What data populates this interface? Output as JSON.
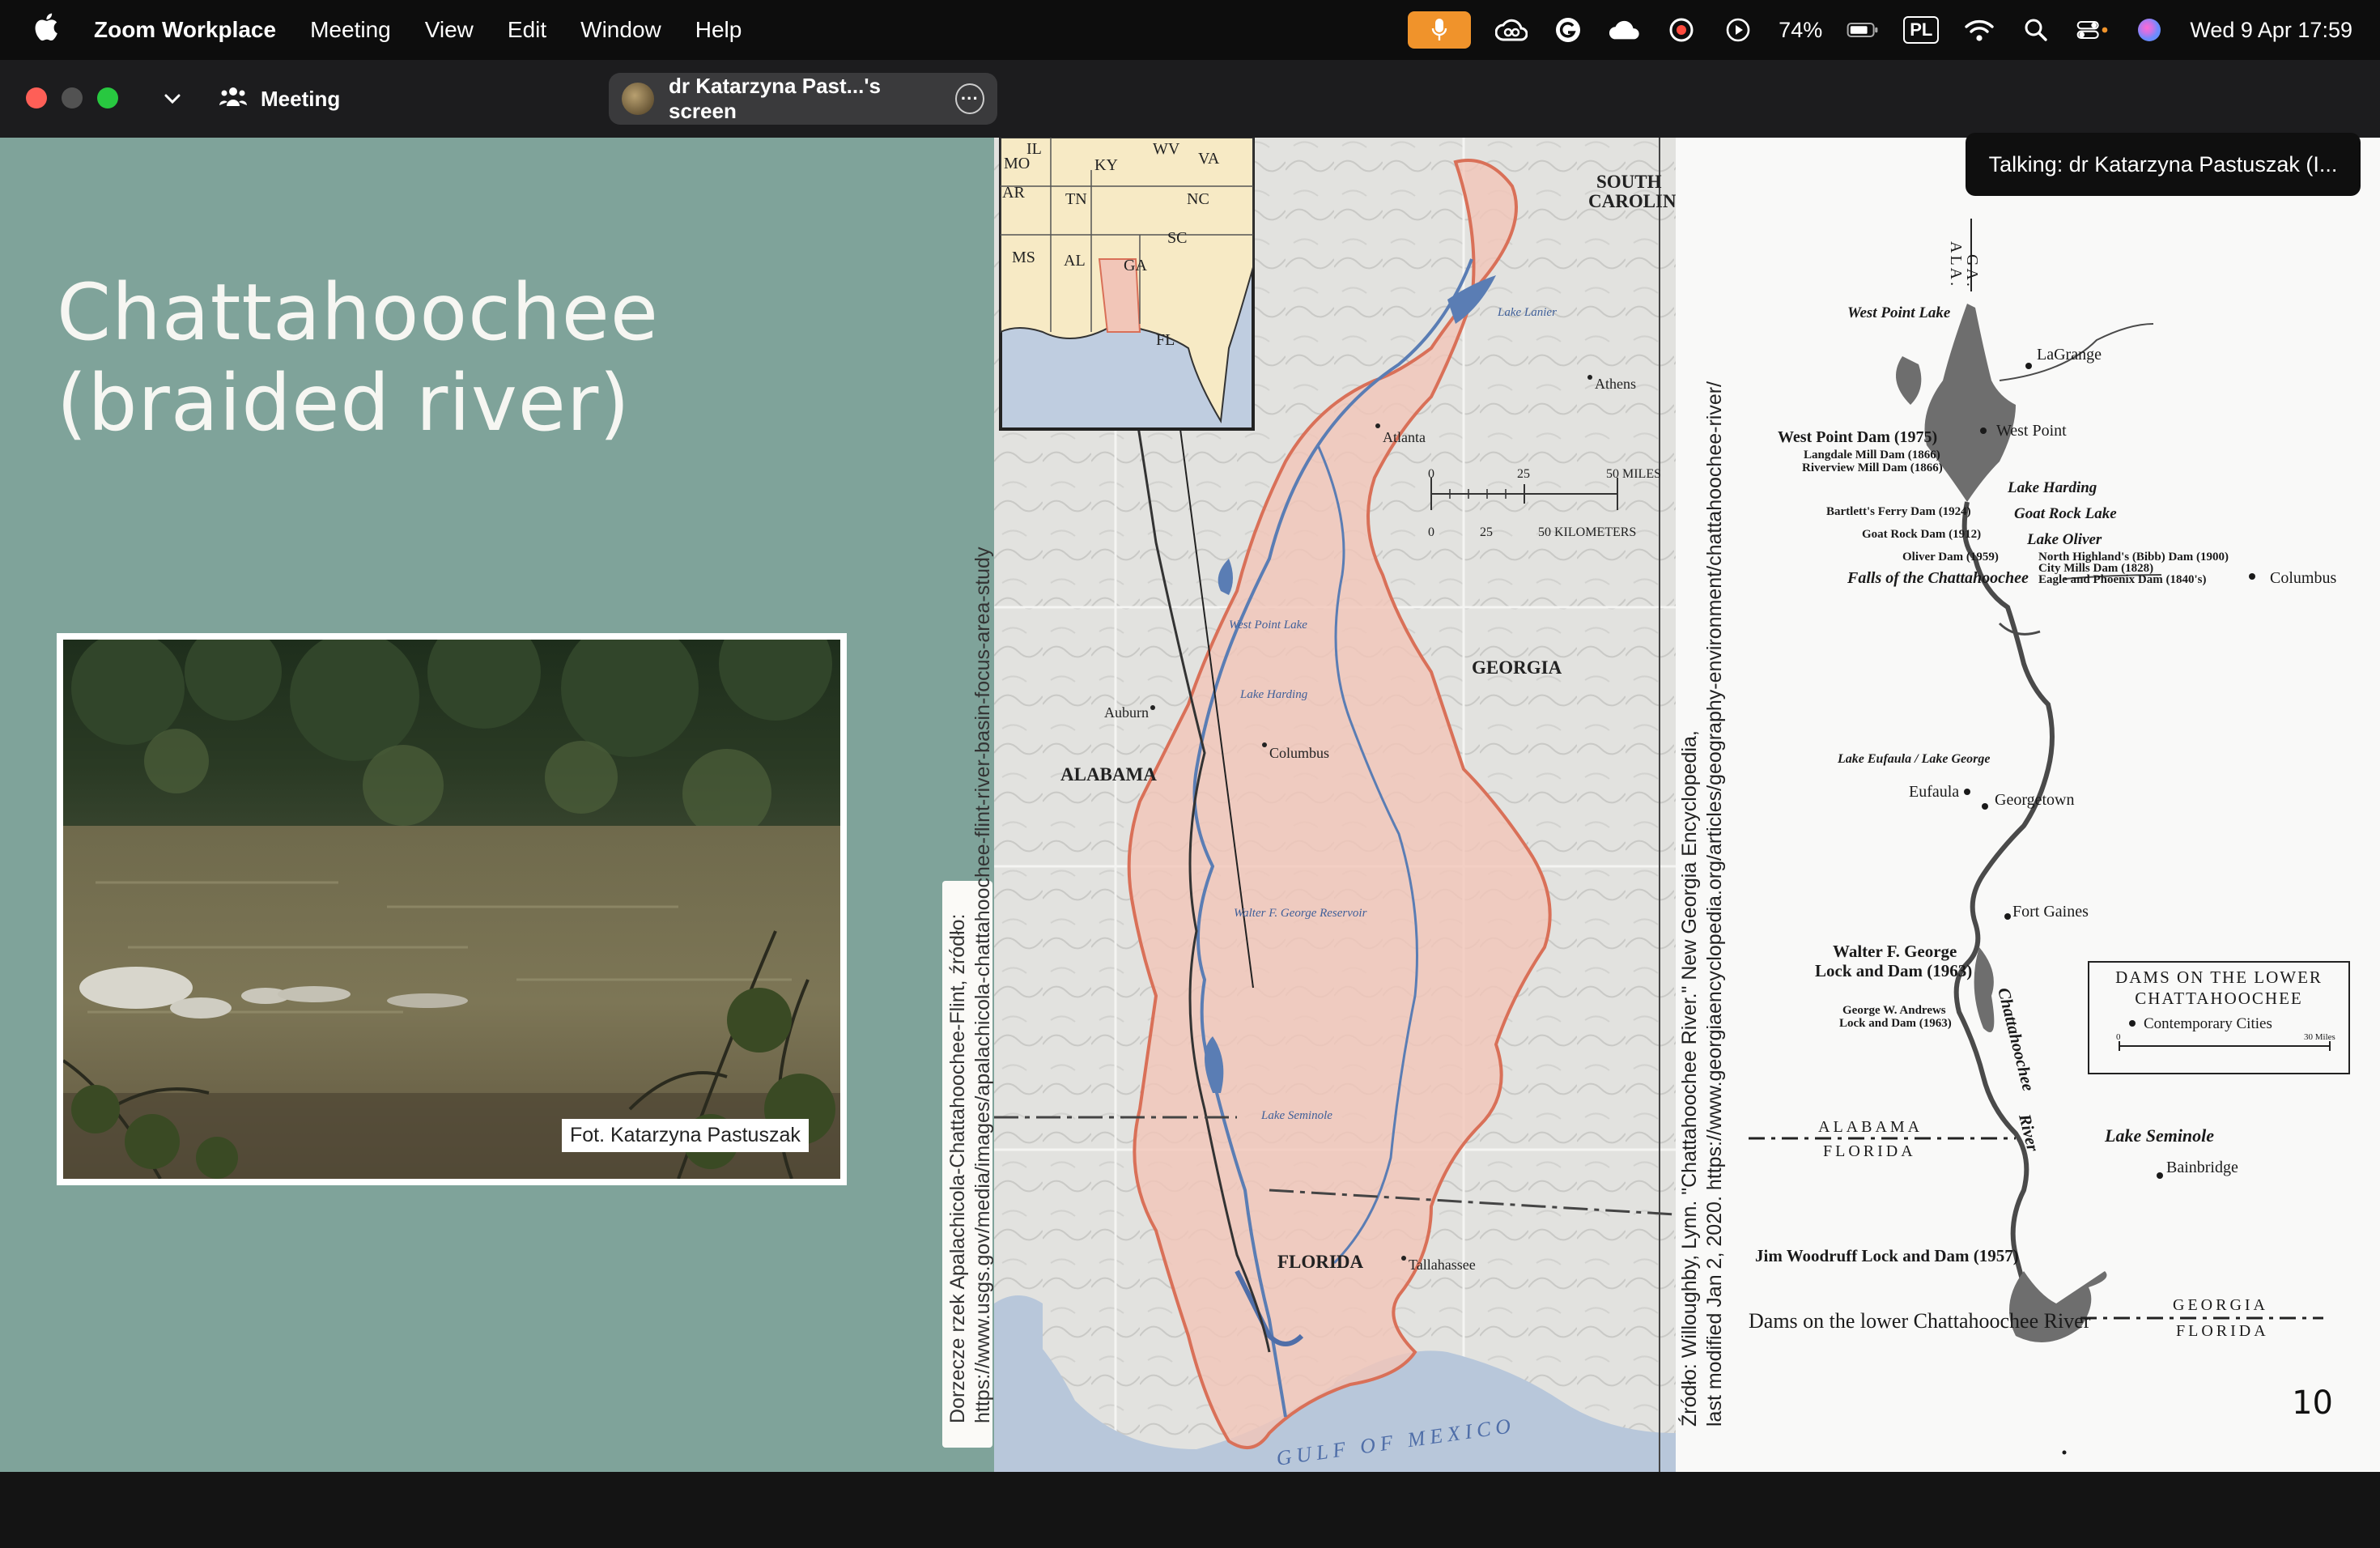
{
  "menubar": {
    "app_name": "Zoom Workplace",
    "menus": [
      "Meeting",
      "View",
      "Edit",
      "Window",
      "Help"
    ],
    "battery_percent": "74%",
    "input_source": "PL",
    "clock": "Wed 9 Apr  17:59"
  },
  "zoombar": {
    "meeting_label": "Meeting",
    "share_label": "dr Katarzyna Past...'s screen"
  },
  "talking": "Talking: dr Katarzyna Pastuszak (I...",
  "slide": {
    "title_line1": "Chattahoochee",
    "title_line2": "(braided river)",
    "photo_credit": "Fot. Katarzyna Pastuszak",
    "source_left_line1": "Dorzecze rzek Apalachicola-Chattahoochee-Flint, źródło:",
    "source_left_line2": "https://www.usgs.gov/media/images/apalachicola-chattahoochee-flint-river-basin-focus-area-study",
    "source_right_line1": "Źródło: Willoughby, Lynn. \"Chattahoochee River.\" New Georgia Encyclopedia,",
    "source_right_line2": "last modified Jan 2, 2020. https://www.georgiaencyclopedia.org/articles/geography-environment/chattahoochee-river/",
    "page_number": "10"
  },
  "map": {
    "states_inset": [
      "IL",
      "KY",
      "WV",
      "VA",
      "MO",
      "TN",
      "NC",
      "AR",
      "SC",
      "MS",
      "AL",
      "GA",
      "FL"
    ],
    "south_carolina": [
      "SOUTH",
      "CAROLINA"
    ],
    "georgia": "GEORGIA",
    "alabama": "ALABAMA",
    "florida": "FLORIDA",
    "cities": [
      "Athens",
      "Atlanta",
      "Auburn",
      "Columbus",
      "Tallahassee"
    ],
    "lakes": [
      "Lake Lanier",
      "West Point Lake",
      "Lake Harding",
      "Walter F. George Reservoir",
      "Lake Seminole"
    ],
    "gulf": "GULF OF MEXICO",
    "scale_miles": [
      "0",
      "25",
      "50 MILES"
    ],
    "scale_km": [
      "0",
      "25",
      "50 KILOMETERS"
    ]
  },
  "dams_chart": {
    "state_top": "GA.",
    "state_top2": "ALA.",
    "west_point_lake": "West Point Lake",
    "lagrange": "LaGrange",
    "west_point_dam": "West Point Dam (1975)",
    "langdale": "Langdale Mill Dam (1866)",
    "riverview": "Riverview Mill Dam (1866)",
    "west_point": "West Point",
    "lake_harding": "Lake Harding",
    "bartletts": "Bartlett's Ferry Dam (1924)",
    "goat_rock_lake": "Goat Rock Lake",
    "goat_rock_dam": "Goat Rock Dam (1912)",
    "lake_oliver": "Lake Oliver",
    "oliver_dam": "Oliver Dam (1959)",
    "north_highlands": "North Highland's (Bibb) Dam (1900)",
    "city_mills": "City Mills Dam (1828)",
    "eagle_phoenix": "Eagle and Phoenix Dam (1840's)",
    "columbus": "Columbus",
    "falls": "Falls of the Chattahoochee",
    "eufaula_lake": "Lake Eufaula / Lake George",
    "eufaula": "Eufaula",
    "georgetown": "Georgetown",
    "walter_george_1": "Walter F. George",
    "walter_george_2": "Lock and Dam (1963)",
    "fort_gaines": "Fort Gaines",
    "andrews_1": "George W. Andrews",
    "andrews_2": "Lock and Dam (1963)",
    "river_name": "Chattahoochee",
    "river_word": "River",
    "alabama": "ALABAMA",
    "florida": "FLORIDA",
    "georgia": "GEORGIA",
    "florida2": "FLORIDA",
    "lake_seminole": "Lake Seminole",
    "bainbridge": "Bainbridge",
    "woodruff": "Jim Woodruff Lock and Dam (1957)",
    "caption": "Dams on the lower Chattahoochee River",
    "legend_title_1": "DAMS ON THE LOWER",
    "legend_title_2": "CHATTAHOOCHEE",
    "legend_item": "Contemporary Cities",
    "legend_scale_0": "0",
    "legend_scale_30": "30 Miles"
  }
}
